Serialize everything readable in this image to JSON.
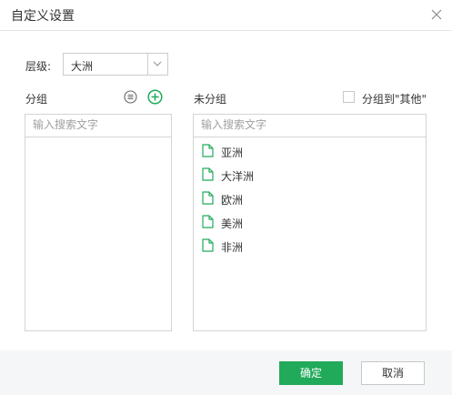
{
  "dialog": {
    "title": "自定义设置",
    "close_icon": "close-icon"
  },
  "level": {
    "label": "层级:",
    "selected": "大洲"
  },
  "groups": {
    "label": "分组",
    "search_placeholder": "输入搜索文字"
  },
  "ungrouped": {
    "label": "未分组",
    "checkbox_label": "分组到\"其他\"",
    "search_placeholder": "输入搜索文字",
    "items": [
      {
        "label": "亚洲"
      },
      {
        "label": "大洋洲"
      },
      {
        "label": "欧洲"
      },
      {
        "label": "美洲"
      },
      {
        "label": "非洲"
      }
    ]
  },
  "footer": {
    "ok_label": "确定",
    "cancel_label": "取消"
  },
  "colors": {
    "accent": "#22aa5b",
    "border": "#d4d4d4",
    "footer_bg": "#f5f6f7"
  }
}
